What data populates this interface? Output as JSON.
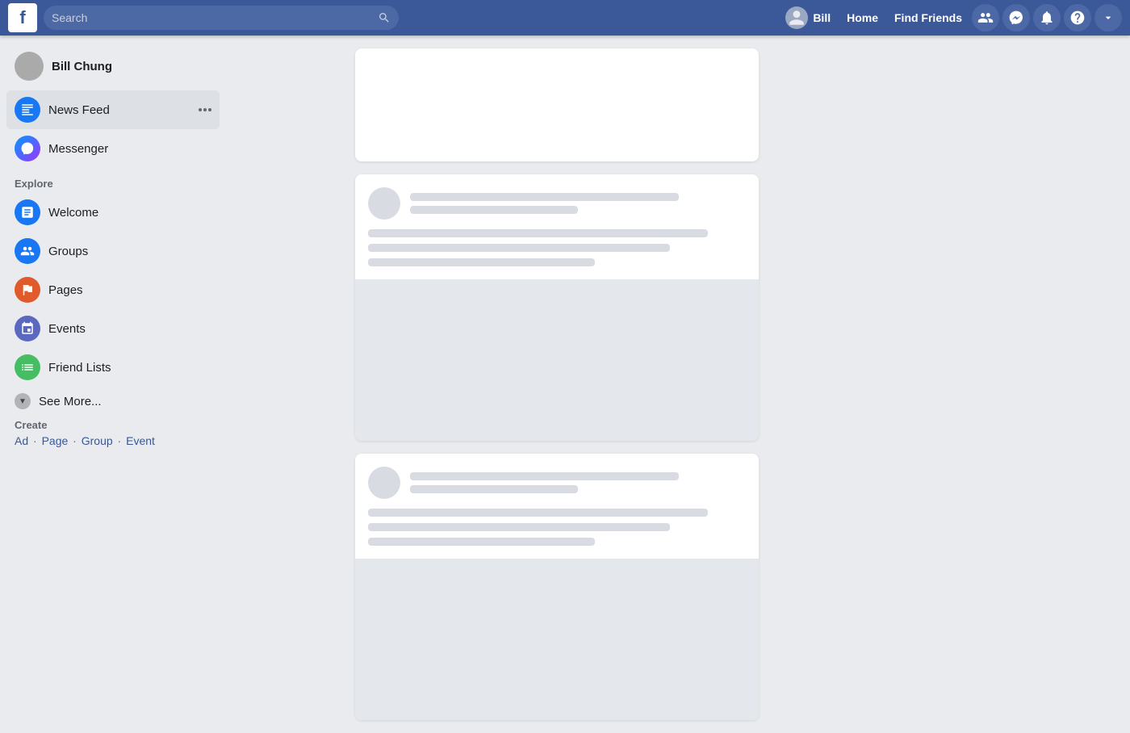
{
  "topnav": {
    "logo": "f",
    "search_placeholder": "Search",
    "user_name": "Bill",
    "home_label": "Home",
    "find_friends_label": "Find Friends",
    "accent_color": "#3b5998"
  },
  "sidebar": {
    "user_name": "Bill Chung",
    "news_feed_label": "News Feed",
    "messenger_label": "Messenger",
    "explore_title": "Explore",
    "explore_items": [
      {
        "label": "Welcome",
        "icon": "facebook-icon"
      },
      {
        "label": "Groups",
        "icon": "groups-icon"
      },
      {
        "label": "Pages",
        "icon": "pages-icon"
      },
      {
        "label": "Events",
        "icon": "events-icon"
      },
      {
        "label": "Friend Lists",
        "icon": "friend-lists-icon"
      }
    ],
    "see_more_label": "See More...",
    "create_title": "Create",
    "create_links": [
      "Ad",
      "Page",
      "Group",
      "Event"
    ]
  },
  "feed": {
    "cards": [
      {
        "type": "empty"
      },
      {
        "type": "skeleton"
      },
      {
        "type": "skeleton"
      }
    ]
  }
}
